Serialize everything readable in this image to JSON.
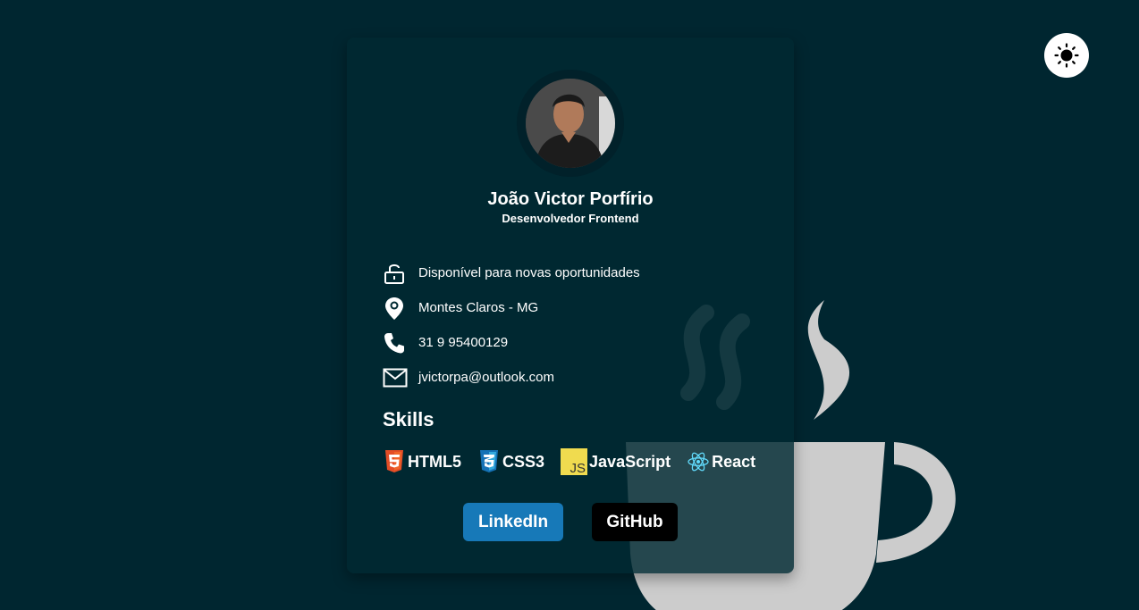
{
  "theme_toggle": {
    "icon": "sun-icon"
  },
  "profile": {
    "name": "João Victor Porfírio",
    "role": "Desenvolvedor Frontend"
  },
  "info": [
    {
      "icon": "unlock-icon",
      "text": "Disponível para novas oportunidades"
    },
    {
      "icon": "location-pin-icon",
      "text": "Montes Claros - MG"
    },
    {
      "icon": "phone-icon",
      "text": "31 9 95400129"
    },
    {
      "icon": "mail-icon",
      "text": "jvictorpa@outlook.com"
    }
  ],
  "skills": {
    "title": "Skills",
    "items": [
      {
        "icon": "html5-icon",
        "label": "HTML5",
        "color": "#e44d26"
      },
      {
        "icon": "css3-icon",
        "label": "CSS3",
        "color": "#1572b6"
      },
      {
        "icon": "javascript-icon",
        "label": "JavaScript",
        "color": "#f0db4f",
        "badge": "JS"
      },
      {
        "icon": "react-icon",
        "label": "React",
        "color": "#61dafb"
      }
    ]
  },
  "buttons": {
    "linkedin": {
      "label": "LinkedIn",
      "color": "#1779b8"
    },
    "github": {
      "label": "GitHub",
      "color": "#000000"
    }
  },
  "colors": {
    "background": "#002630",
    "card": "#002a32",
    "coffee": "#cccccc"
  }
}
